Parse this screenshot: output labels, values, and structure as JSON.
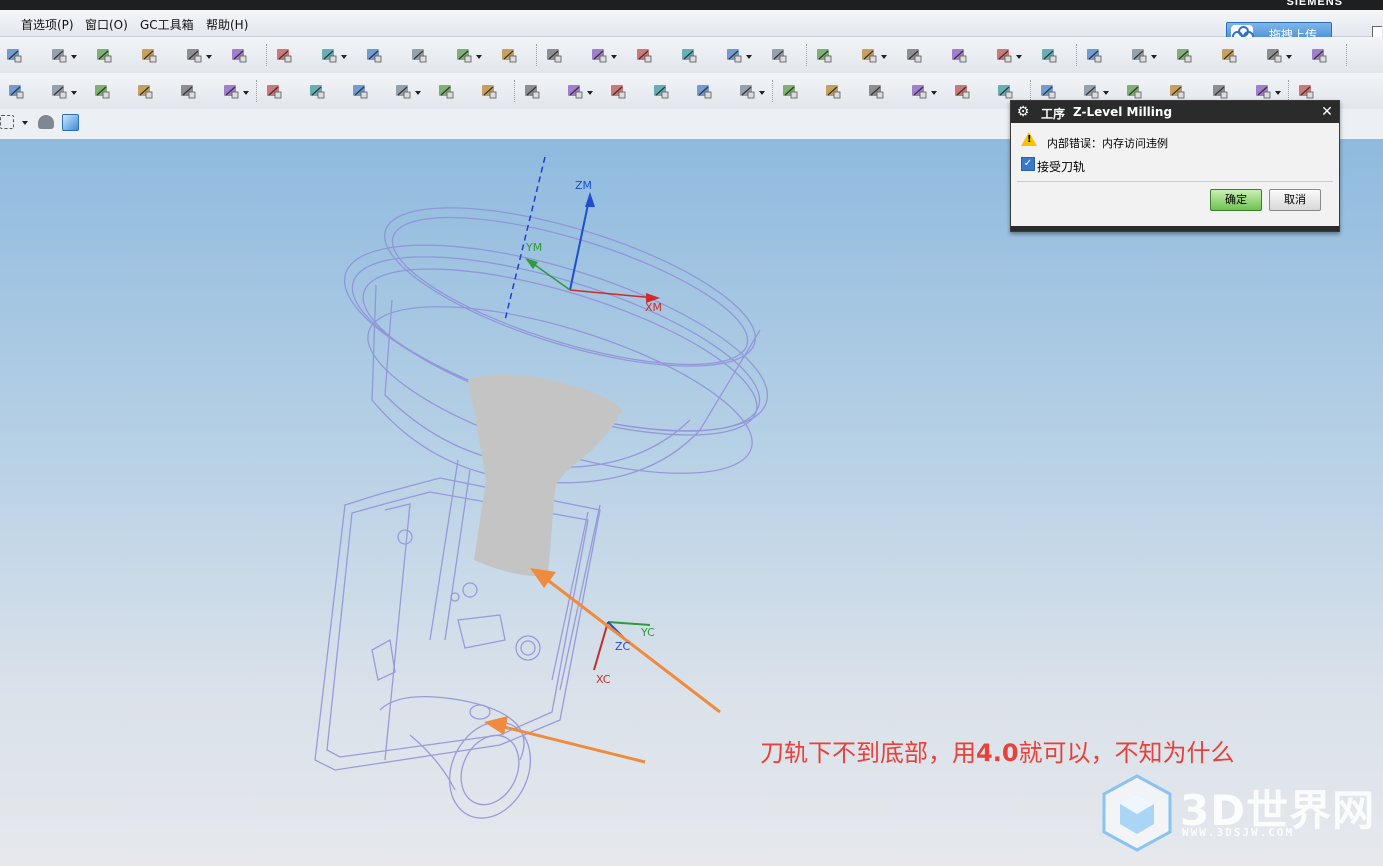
{
  "app": {
    "brand": "SIEMENS"
  },
  "menu": {
    "items": [
      "首选项(P)",
      "窗口(O)",
      "GC工具箱",
      "帮助(H)"
    ]
  },
  "upload": {
    "label": "拖拽上传"
  },
  "toolbar": {
    "row1_icons": [
      "more-chevron-icon",
      "fit-view-icon",
      "render-style-icon",
      "cube-view-icon",
      "layer-icon",
      "wcs-icon",
      "box-frame-icon",
      "section-icon",
      "filter-icon",
      "operation-nav-icon",
      "program-order-icon",
      "machine-tool-icon",
      "geometry-icon",
      "method-icon",
      "verify-icon",
      "simulate-icon",
      "generate-path-icon",
      "replay-path-icon",
      "list-path-icon",
      "post-process-icon",
      "shop-doc-icon",
      "link-icon",
      "line-icon",
      "point-icon",
      "curve-icon",
      "cross-icon",
      "spline-icon",
      "offset-icon",
      "project-icon",
      "mirror-icon"
    ],
    "row2_icons": [
      "path-icon",
      "verify-path-icon",
      "generate-icon",
      "machine-icon",
      "feed-icon",
      "output-icon",
      "cycle-icon",
      "edit-icon",
      "program-icon",
      "method-icon",
      "wave-icon",
      "boundary-icon",
      "area-icon",
      "point-icon",
      "curve-icon",
      "blank-icon",
      "part-icon",
      "fixture-icon",
      "cut-area-icon",
      "trim-icon",
      "tool-icon",
      "tool-holder-icon",
      "nc-icon",
      "transform-icon",
      "copy-icon",
      "object-icon",
      "delete-icon",
      "check-icon",
      "info-icon",
      "table-icon",
      "setup-icon"
    ],
    "row3_icons": [
      "select-box-icon",
      "shade-icon",
      "cube-shade-icon"
    ]
  },
  "dialog": {
    "title_prefix": "工序",
    "title": "Z-Level Milling",
    "message": "内部错误：内存访问违例",
    "checkbox_label": "接受刀轨",
    "checkbox_checked": true,
    "ok_label": "确定",
    "cancel_label": "取消"
  },
  "viewport": {
    "axes_mcs": {
      "z": "ZM",
      "y": "YM",
      "x": "XM"
    },
    "axes_wcs": {
      "y": "YC",
      "z": "ZC",
      "x": "XC"
    }
  },
  "annotation": {
    "text_before": "刀轨下不到底部，用",
    "highlight": "4.0",
    "text_after": "就可以，不知为什么"
  },
  "watermark": {
    "logo_text": "3D世界网",
    "url": "WWW.3DSJW.COM"
  },
  "colors": {
    "accent_arrow": "#f08a3c",
    "annotation": "#e8413a",
    "part_wire": "#8f8fd8"
  }
}
